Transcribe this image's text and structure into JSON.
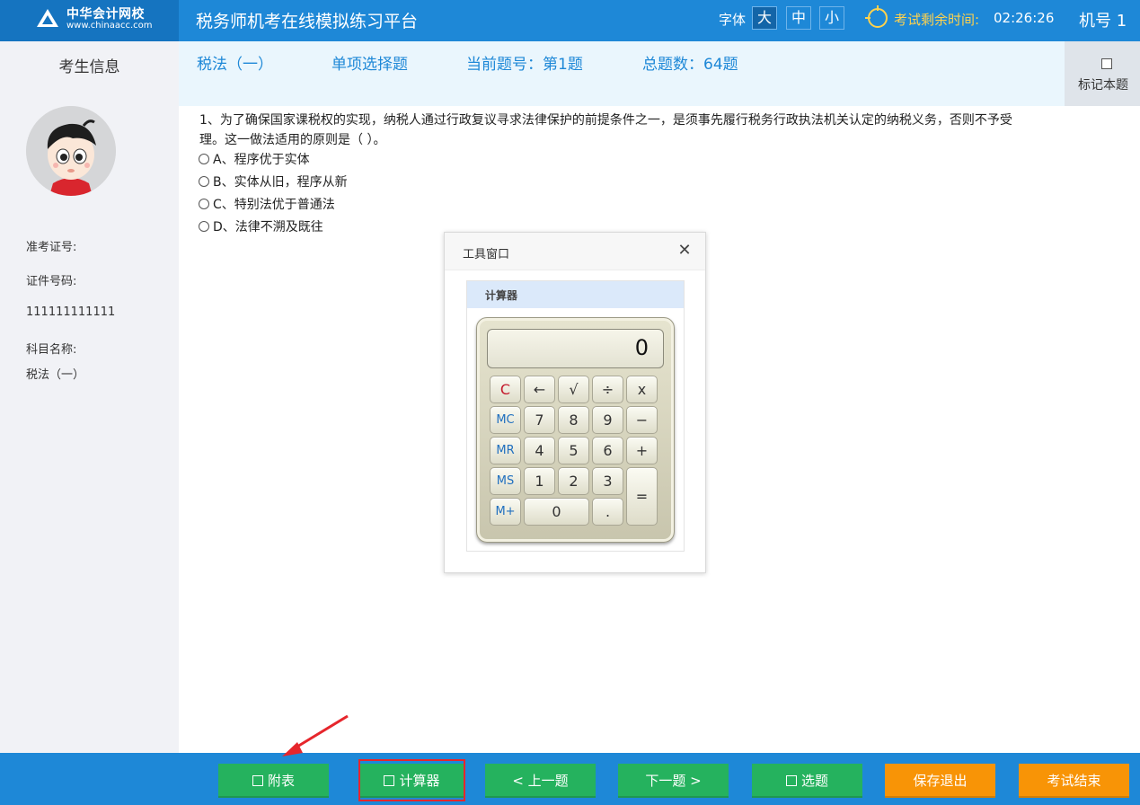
{
  "header": {
    "logo_cn": "中华会计网校",
    "logo_en": "www.chinaacc.com",
    "app_title": "税务师机考在线模拟练习平台",
    "font_label": "字体",
    "font_sizes": [
      "大",
      "中",
      "小"
    ],
    "timer_label": "考试剩余时间:",
    "timer_value": "02:26:26",
    "machine_no": "机号 1"
  },
  "sidebar": {
    "title": "考生信息",
    "exam_id_label": "准考证号:",
    "cert_label": "证件号码:",
    "cert_value": "111111111111",
    "subject_label": "科目名称:",
    "subject_value": "税法（一）"
  },
  "info_bar": {
    "subject": "税法（一）",
    "type": "单项选择题",
    "current": "当前题号：第1题",
    "total": "总题数：64题",
    "mark_label": "标记本题"
  },
  "question": {
    "line1": "1、为了确保国家课税权的实现，纳税人通过行政复议寻求法律保护的前提条件之一，是须事先履行税务行政执法机关认定的纳税义务，否则不予受",
    "line2": "理。这一做法适用的原则是（    ）。",
    "options": [
      "A、程序优于实体",
      "B、实体从旧，程序从新",
      "C、特别法优于普通法",
      "D、法律不溯及既往"
    ]
  },
  "tool_window": {
    "title": "工具窗口",
    "close_glyph": "✕",
    "tab_label": "计算器",
    "display": "0",
    "keys": {
      "clear": "C",
      "back": "←",
      "sqrt": "√",
      "div": "÷",
      "mul": "x",
      "mc": "MC",
      "k7": "7",
      "k8": "8",
      "k9": "9",
      "minus": "−",
      "mr": "MR",
      "k4": "4",
      "k5": "5",
      "k6": "6",
      "plus": "+",
      "ms": "MS",
      "k1": "1",
      "k2": "2",
      "k3": "3",
      "equals": "=",
      "mplus": "M+",
      "k0": "0",
      "dot": "."
    }
  },
  "footer": {
    "appendix": "附表",
    "calculator": "计算器",
    "prev": "< 上一题",
    "next": "下一题 >",
    "select": "选题",
    "save_exit": "保存退出",
    "end_exam": "考试结束"
  },
  "colors": {
    "primary": "#1e88d7",
    "green": "#25b25e",
    "orange": "#f89406",
    "highlight": "#e6262c",
    "timer": "#ffd24d"
  }
}
